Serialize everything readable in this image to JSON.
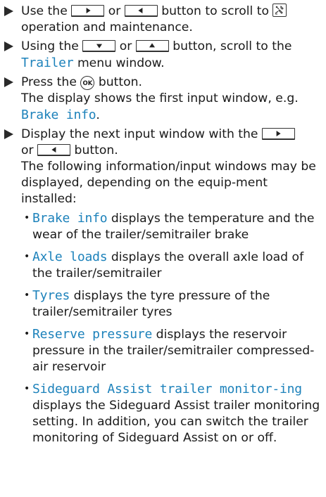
{
  "steps": [
    {
      "pre": "Use the",
      "mid": "or",
      "post": "button to scroll to",
      "tail": "operation and maintenance."
    },
    {
      "pre": "Using the",
      "mid": "or",
      "post": "button, scroll to the",
      "mono": "Trailer",
      "tail": "menu window."
    },
    {
      "pre": "Press the",
      "ok_label": "OK",
      "post": "button.",
      "line2": "The display shows the first input window, e.g.",
      "mono": "Brake info",
      "punct": "."
    },
    {
      "pre": "Display the next input window with the",
      "mid": "or",
      "post": "button.",
      "desc": "The following information/input windows may be displayed, depending on the equip-ment installed:"
    }
  ],
  "bullets": [
    {
      "term": "Brake info",
      "desc": "displays the temperature and the wear of the trailer/semitrailer brake"
    },
    {
      "term": "Axle loads",
      "desc": "displays the overall axle load of the trailer/semitrailer"
    },
    {
      "term": "Tyres",
      "desc": "displays the tyre pressure of the trailer/semitrailer tyres"
    },
    {
      "term": "Reserve pressure",
      "desc": "displays the reservoir pressure in the trailer/semitrailer compressed-air reservoir"
    },
    {
      "term": "Sideguard Assist trailer monitor-ing",
      "desc": "displays the Sideguard Assist trailer monitoring setting. In addition, you can switch the trailer monitoring of Sideguard Assist on or off."
    }
  ],
  "icons": {
    "right_button": "right-arrow-button-icon",
    "left_button": "left-arrow-button-icon",
    "down_button": "down-arrow-button-icon",
    "up_button": "up-arrow-button-icon",
    "ok_button": "ok-button-icon",
    "maintenance": "wrench-maintenance-icon"
  },
  "colors": {
    "mono_text": "#1d82bb",
    "text": "#1a1a1a"
  }
}
